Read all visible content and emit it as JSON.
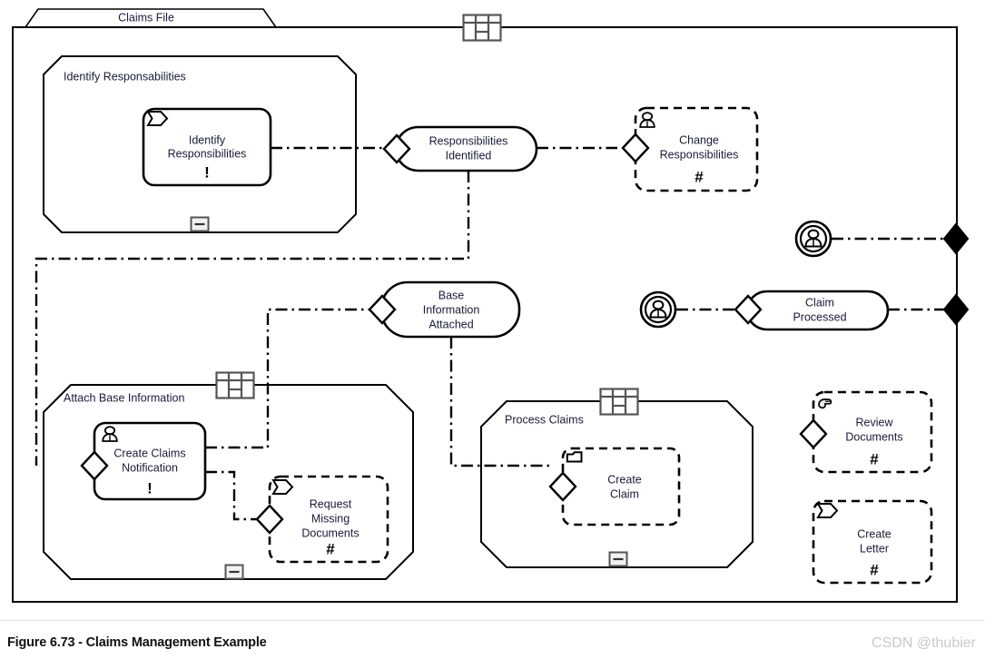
{
  "figure": {
    "caption": "Figure 6.73 - Claims Management Example",
    "watermark": "CSDN @thubier"
  },
  "diagram": {
    "type": "business-process-model",
    "container": {
      "tab_label": "Claims File",
      "name": "claims-file-container"
    },
    "groups": [
      {
        "id": "identify-responsabilities",
        "label": "Identify Responsabilities",
        "shape": "octagon",
        "collapse_glyph": "minus",
        "has_table_icon": false
      },
      {
        "id": "attach-base-information",
        "label": "Attach Base Information",
        "shape": "octagon",
        "collapse_glyph": "minus",
        "has_table_icon": true
      },
      {
        "id": "process-claims",
        "label": "Process Claims",
        "shape": "octagon",
        "collapse_glyph": "minus",
        "has_table_icon": true
      }
    ],
    "tasks": [
      {
        "id": "identify-responsibilities",
        "label_line1": "Identify",
        "label_line2": "Responsibilities",
        "border": "solid",
        "corner_icon": "pentagon-arrow-icon",
        "marker": "!"
      },
      {
        "id": "change-responsibilities",
        "label_line1": "Change",
        "label_line2": "Responsibilities",
        "border": "dashed",
        "corner_icon": "person-icon",
        "marker": "#"
      },
      {
        "id": "create-claims-notification",
        "label_line1": "Create Claims",
        "label_line2": "Notification",
        "border": "solid",
        "corner_icon": "person-icon",
        "marker": "!"
      },
      {
        "id": "request-missing-documents",
        "label_line1": "Request",
        "label_line2": "Missing",
        "label_line3": "Documents",
        "border": "dashed",
        "corner_icon": "pentagon-arrow-icon",
        "marker": "#"
      },
      {
        "id": "create-claim",
        "label_line1": "Create",
        "label_line2": "Claim",
        "border": "dashed",
        "corner_icon": "folder-icon",
        "marker": ""
      },
      {
        "id": "review-documents",
        "label_line1": "Review",
        "label_line2": "Documents",
        "border": "dashed",
        "corner_icon": "hand-icon",
        "marker": "#"
      },
      {
        "id": "create-letter",
        "label_line1": "Create",
        "label_line2": "Letter",
        "border": "dashed",
        "corner_icon": "pentagon-arrow-icon",
        "marker": "#"
      }
    ],
    "states": [
      {
        "id": "responsibilities-identified",
        "label_line1": "Responsibilities",
        "label_line2": "Identified",
        "shape": "stadium"
      },
      {
        "id": "base-information-attached",
        "label_line1": "Base",
        "label_line2": "Information",
        "label_line3": "Attached",
        "shape": "stadium"
      },
      {
        "id": "claim-processed",
        "label_line1": "Claim",
        "label_line2": "Processed",
        "shape": "stadium"
      }
    ],
    "actors": [
      {
        "id": "actor-upper",
        "icon": "actor-circle-icon"
      },
      {
        "id": "actor-lower",
        "icon": "actor-circle-icon"
      }
    ],
    "ports": [
      {
        "id": "port-upper",
        "icon": "filled-diamond-icon"
      },
      {
        "id": "port-lower",
        "icon": "filled-diamond-icon"
      }
    ],
    "colors": {
      "stroke": "#000000",
      "label": "#1a1a3a",
      "background": "#ffffff",
      "watermark": "#c9c9c9"
    }
  }
}
